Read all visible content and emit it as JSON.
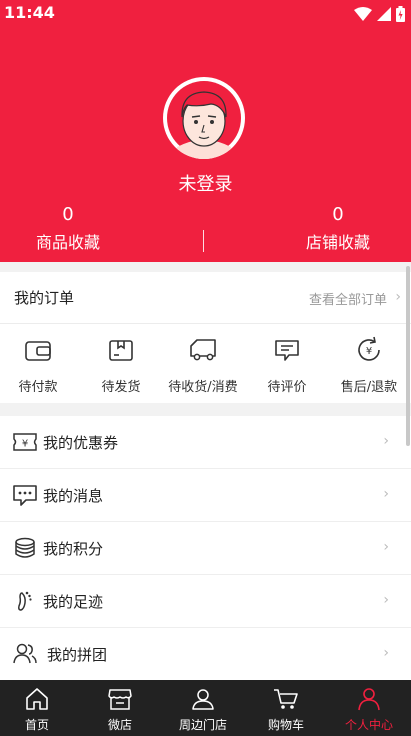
{
  "status_bar": {
    "time": "11:44"
  },
  "profile": {
    "login_text": "未登录",
    "stats": [
      {
        "count": "0",
        "label": "商品收藏"
      },
      {
        "count": "0",
        "label": "店铺收藏"
      }
    ]
  },
  "orders": {
    "title": "我的订单",
    "view_all": "查看全部订单",
    "items": [
      {
        "label": "待付款",
        "icon": "wallet-icon"
      },
      {
        "label": "待发货",
        "icon": "box-icon"
      },
      {
        "label": "待收货/消费",
        "icon": "truck-icon"
      },
      {
        "label": "待评价",
        "icon": "comment-icon"
      },
      {
        "label": "售后/退款",
        "icon": "refund-icon"
      }
    ]
  },
  "menu": [
    {
      "label": "我的优惠券",
      "icon": "coupon-icon"
    },
    {
      "label": "我的消息",
      "icon": "message-icon"
    },
    {
      "label": "我的积分",
      "icon": "points-icon"
    },
    {
      "label": "我的足迹",
      "icon": "footprint-icon"
    },
    {
      "label": "我的拼团",
      "icon": "group-icon"
    }
  ],
  "tabbar": {
    "tabs": [
      {
        "label": "首页",
        "icon": "home-icon"
      },
      {
        "label": "微店",
        "icon": "shop-icon"
      },
      {
        "label": "周边门店",
        "icon": "nearby-store-icon"
      },
      {
        "label": "购物车",
        "icon": "cart-icon"
      },
      {
        "label": "个人中心",
        "icon": "user-icon",
        "active": true
      }
    ]
  },
  "colors": {
    "primary": "#f0203f",
    "tabbar_bg": "#222222"
  }
}
